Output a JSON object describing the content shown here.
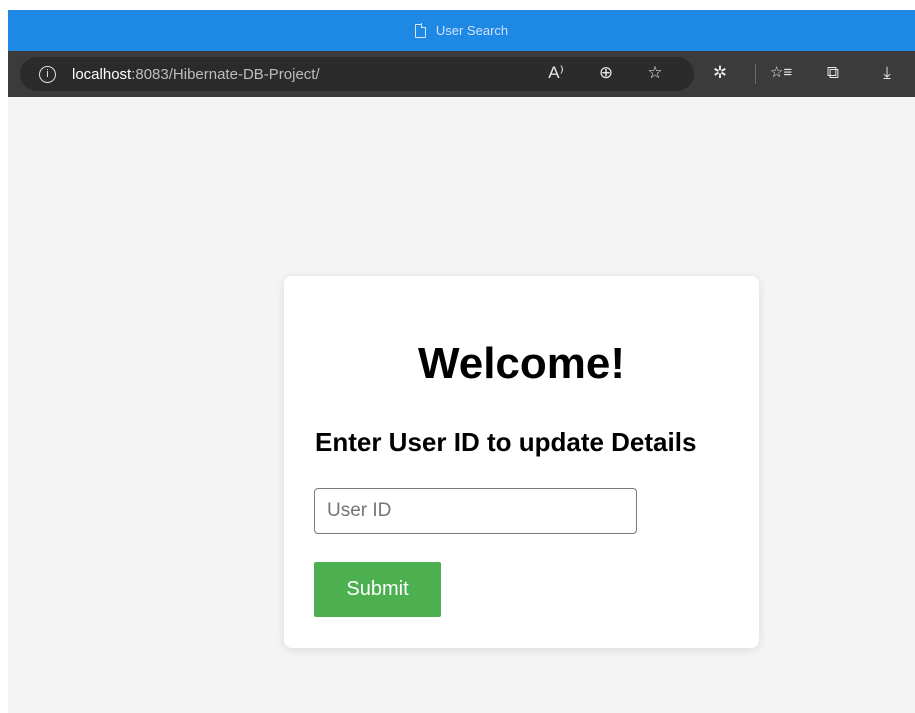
{
  "window": {
    "title": "User Search",
    "icon": "page-icon"
  },
  "address_bar": {
    "host": "localhost",
    "path": ":8083/Hibernate-DB-Project/",
    "info_icon": "info-icon"
  },
  "toolbar": {
    "read_aloud_glyph": "A⁾",
    "zoom_glyph": "⊕",
    "favorite_glyph": "☆",
    "extensions_glyph": "✲",
    "favorites_glyph": "☆≡",
    "collections_glyph": "⧉",
    "downloads_glyph": "⤓"
  },
  "card": {
    "heading": "Welcome!",
    "subheading": "Enter User ID to update Details",
    "input_placeholder": "User ID",
    "input_value": "",
    "submit_label": "Submit"
  },
  "colors": {
    "titlebar": "#1e88e5",
    "submit": "#4caf50",
    "page_bg": "#f4f4f4"
  }
}
